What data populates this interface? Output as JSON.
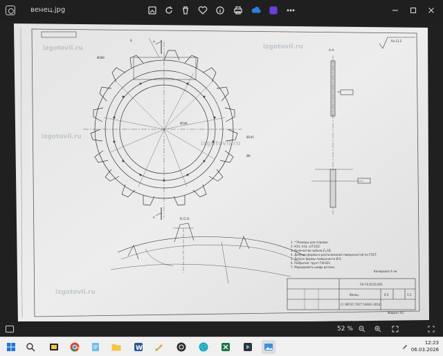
{
  "window": {
    "file_name": "венец.jpg"
  },
  "statusbar": {
    "zoom": "52 %"
  },
  "clock": {
    "time": "12:23",
    "date": "06.03.2026"
  },
  "drawing": {
    "watermark": "izgotovil.ru",
    "section_aa": "A–A",
    "section_bb": "В (1:2)",
    "roughness": "Ra 12.5",
    "doc_number": "СН-74.0115.001",
    "part_name": "Венец",
    "material": "Ст 09Г2С ГОСТ 19281–2014",
    "sheet_note": "Копировал  А ли",
    "format": "Формат А3",
    "label_a": "А",
    "label_b": "Б",
    "dim_d1": "Ø389",
    "dim_d2": "Ø346",
    "dim_d3": "Ø245",
    "dim_t": "Ø6",
    "tbl_scale": "1:1",
    "tbl_mass": "0,5",
    "notes": [
      "1. * Размеры для справок.",
      "2. H14, h14, ±IT14/2.",
      "3. Количество зубьев Z=18.",
      "4. Допуски формы и расположения поверхностей по ГОСТ.",
      "5. Допуск формы поверхности Ø 6.",
      "6. Покрытие: грунт ГФ-021.",
      "7. Маркировать шифр детали."
    ]
  },
  "taskbar": {
    "icons": [
      "windows-start-icon",
      "search-icon",
      "file-explorer-icon",
      "chrome-icon",
      "notepad-icon",
      "folder-icon",
      "word-icon",
      "paint-icon",
      "obs-icon",
      "edge-icon",
      "excel-icon",
      "media-player-icon",
      "image-viewer-icon"
    ]
  }
}
